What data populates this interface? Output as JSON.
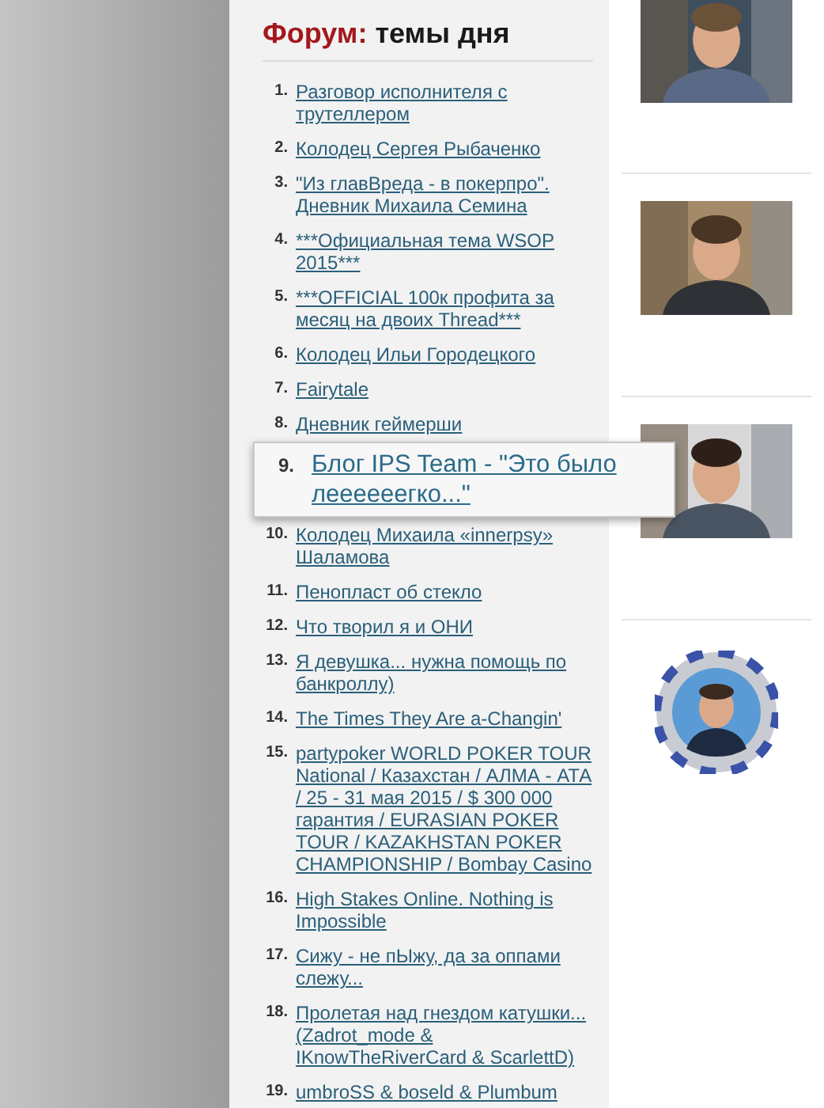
{
  "forum": {
    "title_accent": "Форум:",
    "title_rest": "темы дня",
    "topics": [
      {
        "number": "1.",
        "title": "Разговор исполнителя с трутеллером",
        "highlighted": false
      },
      {
        "number": "2.",
        "title": "Колодец Сергея Рыбаченко",
        "highlighted": false
      },
      {
        "number": "3.",
        "title": "\"Из главВреда - в покерпро\". Дневник Михаила Семина",
        "highlighted": false
      },
      {
        "number": "4.",
        "title": "***Официальная тема WSOP 2015***",
        "highlighted": false
      },
      {
        "number": "5.",
        "title": "***OFFICIAL 100к профита за месяц на двоих Thread***",
        "highlighted": false
      },
      {
        "number": "6.",
        "title": "Колодец Ильи Городецкого",
        "highlighted": false
      },
      {
        "number": "7.",
        "title": "Fairytale",
        "highlighted": false
      },
      {
        "number": "8.",
        "title": "Дневник геймерши",
        "highlighted": false
      },
      {
        "number": "9.",
        "title": "Блог IPS Team - \"Это было леееееегко...\"",
        "highlighted": true
      },
      {
        "number": "10.",
        "title": "Колодец Михаила «innerpsy» Шаламова",
        "highlighted": false
      },
      {
        "number": "11.",
        "title": "Пенопласт об стекло",
        "highlighted": false
      },
      {
        "number": "12.",
        "title": "Что творил я и ОНИ",
        "highlighted": false
      },
      {
        "number": "13.",
        "title": "Я девушка... нужна помощь по банкроллу)",
        "highlighted": false
      },
      {
        "number": "14.",
        "title": "The Times They Are a-Changin'",
        "highlighted": false
      },
      {
        "number": "15.",
        "title": "partypoker WORLD POKER TOUR National / Казахстан / АЛМА - АТА / 25 - 31 мая 2015 / $ 300 000 гарантия / EURASIAN POKER TOUR / KAZAKHSTAN POKER CHAMPIONSHIP / Bombay Casino",
        "highlighted": false
      },
      {
        "number": "16.",
        "title": "High Stakes Online. Nothing is Impossible",
        "highlighted": false
      },
      {
        "number": "17.",
        "title": "Сижу - не пЫжу, да за оппами слежу...",
        "highlighted": false
      },
      {
        "number": "18.",
        "title": "Пролетая над гнездом катушки... (Zadrot_mode & IKnowTheRiverCard & ScarlettD)",
        "highlighted": false
      },
      {
        "number": "19.",
        "title": "umbroSS & boseld & Plumbum",
        "highlighted": false
      }
    ]
  },
  "side_pictures": [
    {
      "kind": "picture"
    },
    {
      "kind": "picture"
    },
    {
      "kind": "picture"
    },
    {
      "kind": "chip"
    }
  ]
}
